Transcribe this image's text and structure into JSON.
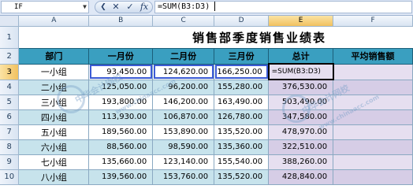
{
  "formula_bar": {
    "name_box": "IF",
    "icons": [
      "dropdown-icon",
      "cancel-icon",
      "enter-icon",
      "function-icon"
    ],
    "formula": "=SUM(B3:D3)"
  },
  "columns": [
    "A",
    "B",
    "C",
    "D",
    "E",
    "F"
  ],
  "rows": [
    "1",
    "2",
    "3",
    "4",
    "5",
    "6",
    "7",
    "8",
    "9",
    "10"
  ],
  "title": "销售部季度销售业绩表",
  "headers": [
    "部门",
    "一月份",
    "二月份",
    "三月份",
    "总计",
    "平均销售额"
  ],
  "data_rows": [
    {
      "dept": "一小组",
      "jan": "93,450.00",
      "feb": "124,620.00",
      "mar": "166,250.00",
      "total": "=SUM(B3:D3)",
      "avg": ""
    },
    {
      "dept": "二小组",
      "jan": "125,050.00",
      "feb": "96,200.00",
      "mar": "155,280.00",
      "total": "376,530.00",
      "avg": ""
    },
    {
      "dept": "三小组",
      "jan": "193,800.00",
      "feb": "146,200.00",
      "mar": "163,490.00",
      "total": "503,490.00",
      "avg": ""
    },
    {
      "dept": "四小组",
      "jan": "113,930.00",
      "feb": "106,870.00",
      "mar": "126,780.00",
      "total": "347,580.00",
      "avg": ""
    },
    {
      "dept": "五小组",
      "jan": "189,560.00",
      "feb": "153,890.00",
      "mar": "135,520.00",
      "total": "478,970.00",
      "avg": ""
    },
    {
      "dept": "六小组",
      "jan": "88,560.00",
      "feb": "98,590.00",
      "mar": "135,360.00",
      "total": "322,510.00",
      "avg": ""
    },
    {
      "dept": "七小组",
      "jan": "135,660.00",
      "feb": "123,140.00",
      "mar": "155,540.00",
      "total": "388,260.00",
      "avg": ""
    },
    {
      "dept": "八小组",
      "jan": "139,560.00",
      "feb": "153,760.00",
      "mar": "135,520.00",
      "total": "428,840.00",
      "avg": ""
    }
  ],
  "watermark": [
    "中华会计网校",
    "www.chinaacc.com"
  ]
}
